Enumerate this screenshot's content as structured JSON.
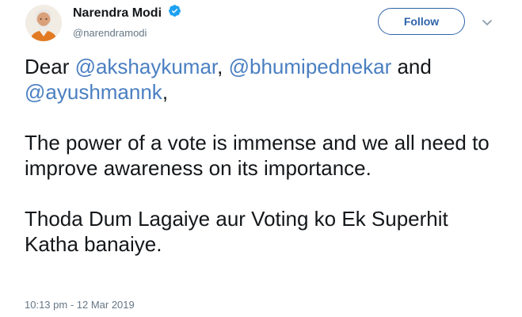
{
  "user": {
    "display_name": "Narendra Modi",
    "handle": "@narendramodi",
    "verified": true,
    "avatar_icon": "user-avatar-photo"
  },
  "follow_button": {
    "label": "Follow"
  },
  "menu_icon": "chevron-down-icon",
  "tweet": {
    "line1_prefix": "Dear ",
    "mention1": "@akshaykumar",
    "line1_sep": ", ",
    "mention2": "@bhumipednekar",
    "line1_and": " and",
    "mention3": "@ayushmannk",
    "line2_suffix": ",",
    "paragraph2": "The power of a vote is immense and we all need to improve awareness on its importance.",
    "paragraph3": "Thoda Dum Lagaiye aur Voting ko Ek Superhit Katha banaiye."
  },
  "timestamp": "10:13 pm - 12 Mar 2019",
  "colors": {
    "mention": "#4a7fc1",
    "follow_border": "#2f63a9",
    "verified": "#1da1f2",
    "meta_text": "#657786"
  }
}
